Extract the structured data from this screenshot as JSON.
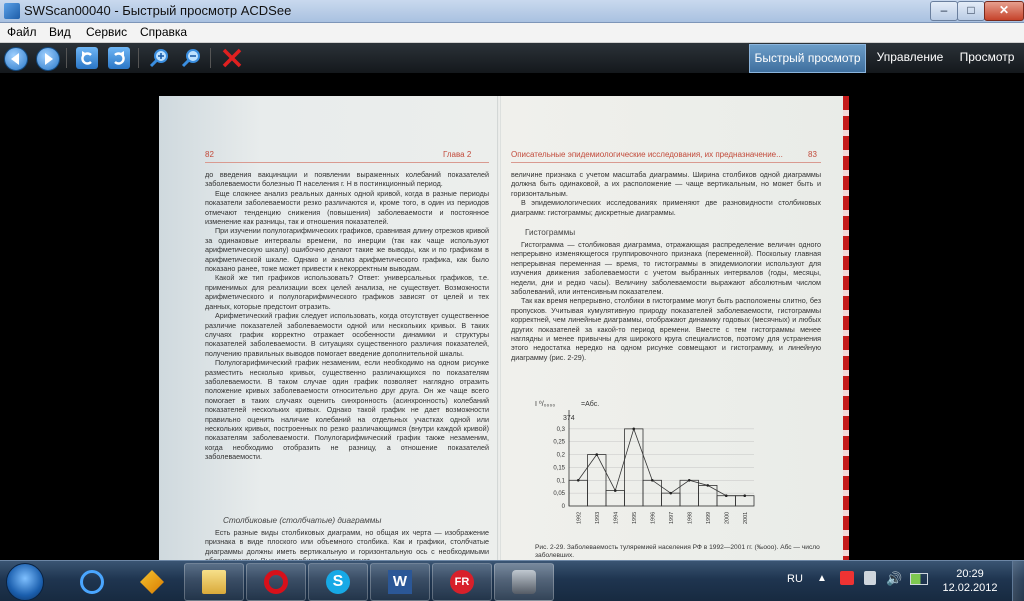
{
  "window": {
    "title": "SWScan00040 - Быстрый просмотр ACDSee",
    "min": "–",
    "max": "□",
    "close": "✕"
  },
  "menu": [
    "Файл",
    "Вид",
    "Сервис",
    "Справка"
  ],
  "modes": [
    "Быстрый просмотр",
    "Управление",
    "Просмотр"
  ],
  "page": {
    "left_num": "82",
    "left_chapter": "Глава 2",
    "right_title": "Описательные эпидемиологические исследования, их предназначение...",
    "right_num": "83",
    "left_text": [
      "до введения вакцинации и появлении выраженных колебаний показателей заболеваемости болезнью П населения г. Н в постинкционный период.",
      "Еще сложнее анализ реальных данных одной кривой, когда в разные периоды показатели заболеваемости резко различаются и, кроме того, в один из периодов отмечают тенденцию снижения (повышения) заболеваемости и постоянное изменение как разницы, так и отношения показателей.",
      "При изучении полулогарифмических графиков, сравнивая длину отрезков кривой за одинаковые интервалы времени, по инерции (так как чаще используют арифметическую шкалу) ошибочно делают такие же выводы, как и по графикам в арифметической шкале. Однако и анализ арифметического графика, как было показано ранее, тоже может привести к некорректным выводам.",
      "Какой же тип графиков использовать? Ответ: универсальных графиков, т.е. применимых для реализации всех целей анализа, не существует. Возможности арифметического и полулогарифмического графиков зависят от целей и тех данных, которые предстоит отразить.",
      "Арифметический график следует использовать, когда отсутствует существенное различие показателей заболеваемости одной или нескольких кривых. В таких случаях график корректно отражает особенности динамики и структуры показателей заболеваемости. В ситуациях существенного различия показателей, получению правильных выводов помогает введение дополнительной шкалы.",
      "Полулогарифмический график незаменим, если необходимо на одном рисунке разместить несколько кривых, существенно различающихся по показателям заболеваемости. В таком случае один график позволяет наглядно отразить положение кривых заболеваемости относительно друг друга. Он же чаще всего помогает в таких случаях оценить синхронность (асинхронность) колебаний показателей нескольких кривых. Однако такой график не дает возможности правильно оценить наличие колебаний на отдельных участках одной или нескольких кривых, построенных по резко различающимся (внутри каждой кривой) показателям заболеваемости. Полулогарифмический график также незаменим, когда необходимо отобразить не разницу, а отношение показателей заболеваемости."
    ],
    "left_heading": "Столбиковые (столбчатые) диаграммы",
    "left_tail": "Есть разные виды столбиковых диаграмм, но общая их черта — изображение признака в виде плоского или объемного столбика. Как и графики, столбчатые диаграммы должны иметь вертикальную и горизонтальную ось с необходимыми обозначениями. Высота столбиков соответствует",
    "right_text_top": [
      "величине признака с учетом масштаба диаграммы. Ширина столбиков одной диаграммы должна быть одинаковой, а их расположение — чаще вертикальным, но может быть и горизонтальным.",
      "В эпидемиологических исследованиях применяют две разновидности столбиковых диаграмм: гистограммы; дискретные диаграммы."
    ],
    "right_heading": "Гистограммы",
    "right_text": [
      "Гистограмма — столбиковая диаграмма, отражающая распределение величин одного непрерывно изменяющегося группировочного признака (переменной). Поскольку главная непрерывная переменная — время, то гистограммы в эпидемиологии используют для изучения движения заболеваемости с учетом выбранных интервалов (годы, месяцы, недели, дни и редко часы). Величину заболеваемости выражают абсолютным числом заболеваний, или интенсивным показателем.",
      "Так как время непрерывно, столбики в гистограмме могут быть расположены слитно, без пропусков. Учитывая кумулятивную природу показателей заболеваемости, гистограммы корректней, чем линейные диаграммы, отображают динамику годовых (месячных) и любых других показателей за какой-то период времени. Вместе с тем гистограммы менее наглядны и менее привычны для широкого круга специалистов, поэтому для устранения этого недостатка нередко на одном рисунке совмещают и гистограмму, и линейную диаграмму (рис. 2-29)."
    ],
    "caption": "Рис. 2-29. Заболеваемость туляремией населения РФ в 1992—2001 гг. (‰ооо). Абс — число заболевших.",
    "y_unit": "I ⁰/₀₀₀₀",
    "y_abs": "=Абс.",
    "peak_label": "374"
  },
  "chart_data": {
    "type": "bar",
    "categories": [
      "1992",
      "1993",
      "1994",
      "1995",
      "1996",
      "1997",
      "1998",
      "1999",
      "2000",
      "2001"
    ],
    "values": [
      0.1,
      0.2,
      0.06,
      0.3,
      0.1,
      0.05,
      0.1,
      0.08,
      0.04,
      0.04
    ],
    "line_values": [
      0.1,
      0.2,
      0.06,
      0.3,
      0.1,
      0.05,
      0.1,
      0.08,
      0.04,
      0.04
    ],
    "yticks": [
      "0",
      "0,05",
      "0,1",
      "0,15",
      "0,2",
      "0,25",
      "0,3"
    ],
    "ylim": [
      0,
      0.35
    ]
  },
  "taskbar": {
    "lang": "RU",
    "time": "20:29",
    "date": "12.02.2012"
  }
}
